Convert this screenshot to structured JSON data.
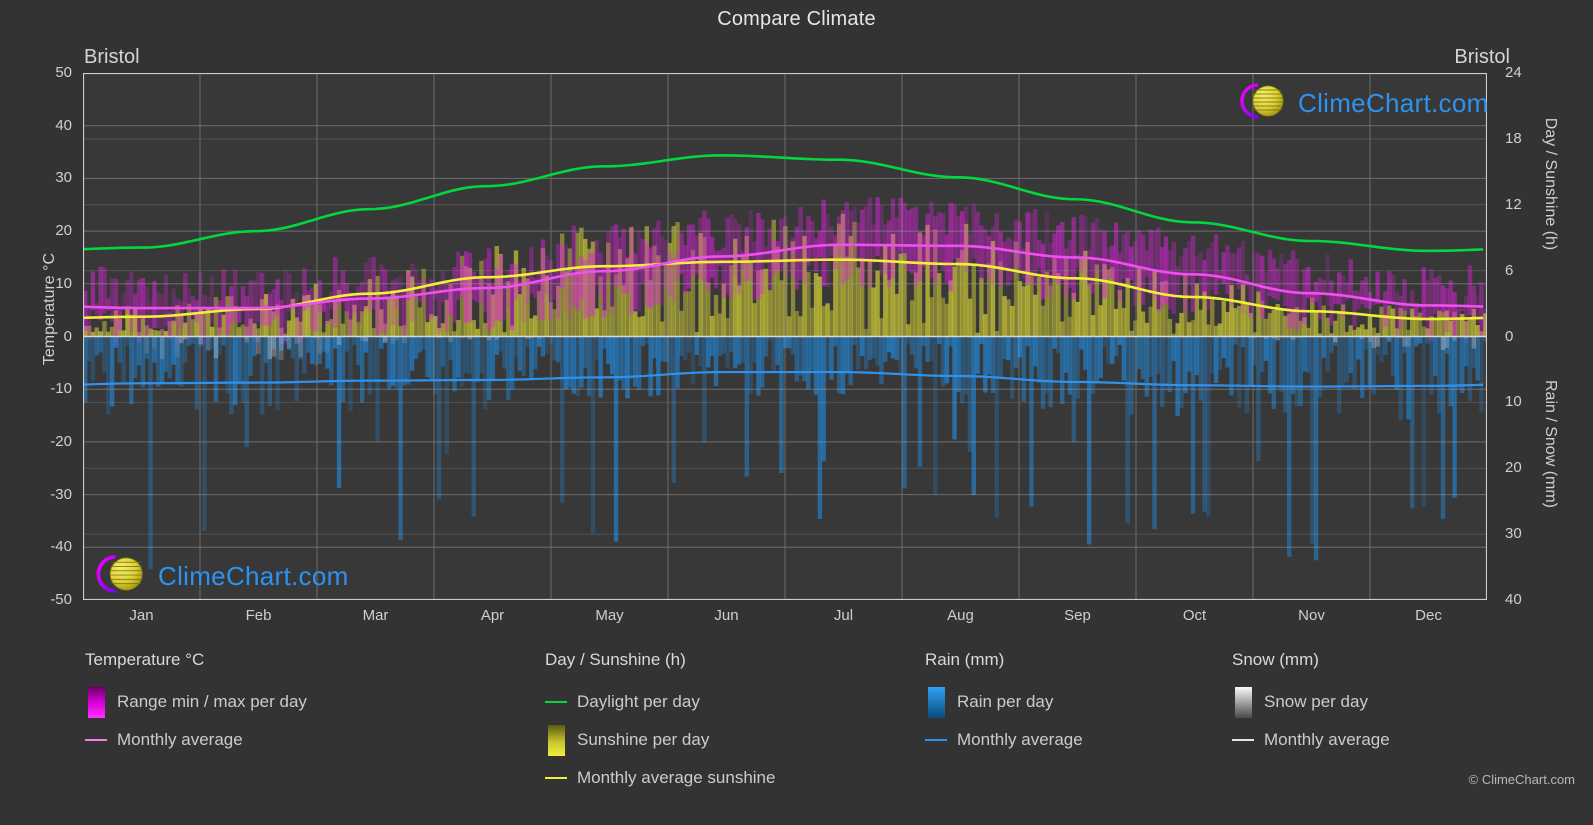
{
  "header": {
    "title": "Compare Climate",
    "station_left": "Bristol",
    "station_right": "Bristol"
  },
  "branding": {
    "logo_text": "ClimeChart.com",
    "copyright": "© ClimeChart.com"
  },
  "axes": {
    "left_title": "Temperature °C",
    "right_top_title": "Day / Sunshine (h)",
    "right_bottom_title": "Rain / Snow (mm)",
    "left_ticks": [
      "50",
      "40",
      "30",
      "20",
      "10",
      "0",
      "-10",
      "-20",
      "-30",
      "-40",
      "-50"
    ],
    "right_ticks": [
      "24",
      "18",
      "12",
      "6",
      "0",
      "10",
      "20",
      "30",
      "40"
    ],
    "x_ticks": [
      "Jan",
      "Feb",
      "Mar",
      "Apr",
      "May",
      "Jun",
      "Jul",
      "Aug",
      "Sep",
      "Oct",
      "Nov",
      "Dec"
    ]
  },
  "legend": {
    "temperature": {
      "heading": "Temperature °C",
      "items": [
        {
          "label": "Range min / max per day",
          "swatch": "gradient-magenta",
          "color": "#ff00ff"
        },
        {
          "label": "Monthly average",
          "swatch": "line",
          "color": "#ee7fee"
        }
      ]
    },
    "day_sunshine": {
      "heading": "Day / Sunshine (h)",
      "items": [
        {
          "label": "Daylight per day",
          "swatch": "line",
          "color": "#00d83c"
        },
        {
          "label": "Sunshine per day",
          "swatch": "gradient-yellow",
          "color": "#f0ee28"
        },
        {
          "label": "Monthly average sunshine",
          "swatch": "line",
          "color": "#f2ef3a"
        }
      ]
    },
    "rain": {
      "heading": "Rain (mm)",
      "items": [
        {
          "label": "Rain per day",
          "swatch": "gradient-blue",
          "color": "#1f8fe8"
        },
        {
          "label": "Monthly average",
          "swatch": "line",
          "color": "#2e93f0"
        }
      ]
    },
    "snow": {
      "heading": "Snow (mm)",
      "items": [
        {
          "label": "Snow per day",
          "swatch": "gradient-white",
          "color": "#f2f2f2"
        },
        {
          "label": "Monthly average",
          "swatch": "line",
          "color": "#e6e6e6"
        }
      ]
    }
  },
  "chart_data": {
    "type": "line",
    "title": "Compare Climate",
    "subtitle": "Bristol",
    "xlabel": "",
    "ylabel": "Temperature °C",
    "ylabel_right_top": "Day / Sunshine (h)",
    "ylabel_right_bottom": "Rain / Snow (mm)",
    "ylim": [
      -50,
      50
    ],
    "ylim_right_top": [
      0,
      24
    ],
    "ylim_right_bottom": [
      0,
      40
    ],
    "grid": true,
    "legend_position": "below",
    "categories": [
      "Jan",
      "Feb",
      "Mar",
      "Apr",
      "May",
      "Jun",
      "Jul",
      "Aug",
      "Sep",
      "Oct",
      "Nov",
      "Dec"
    ],
    "series": [
      {
        "name": "Daylight per day",
        "unit": "h",
        "axis": "right_top",
        "color": "#00d83c",
        "values": [
          8.1,
          9.6,
          11.6,
          13.7,
          15.5,
          16.5,
          16.1,
          14.5,
          12.5,
          10.4,
          8.7,
          7.8
        ]
      },
      {
        "name": "Monthly average sunshine",
        "unit": "h",
        "axis": "right_top",
        "color": "#f2ef3a",
        "values": [
          1.8,
          2.5,
          3.9,
          5.4,
          6.4,
          6.8,
          7.0,
          6.6,
          5.3,
          3.6,
          2.3,
          1.6
        ]
      },
      {
        "name": "Monthly average temperature",
        "unit": "°C",
        "axis": "left",
        "color": "#ee7fee",
        "values": [
          5.4,
          5.4,
          7.2,
          9.2,
          12.4,
          15.2,
          17.4,
          17.2,
          15.0,
          11.8,
          8.2,
          5.9
        ]
      },
      {
        "name": "Monthly average rain",
        "unit": "mm",
        "axis": "right_bottom",
        "color": "#2e93f0",
        "values": [
          7.1,
          7.0,
          6.7,
          6.6,
          6.2,
          5.4,
          5.4,
          6.0,
          6.9,
          7.4,
          7.6,
          7.5
        ]
      },
      {
        "name": "Temperature range min / max per day",
        "unit": "°C",
        "axis": "left",
        "color": "#ff00ff",
        "min_values": [
          1.9,
          1.7,
          3.0,
          4.4,
          7.3,
          10.2,
          12.4,
          12.3,
          10.3,
          7.8,
          4.5,
          2.3
        ],
        "max_values": [
          8.9,
          9.1,
          11.4,
          14.0,
          17.4,
          20.2,
          22.4,
          22.1,
          19.6,
          15.7,
          11.8,
          9.4
        ]
      },
      {
        "name": "Sunshine per day",
        "unit": "h",
        "axis": "right_top",
        "color": "#f0ee28",
        "values": [
          1.8,
          2.5,
          3.9,
          5.4,
          6.4,
          6.8,
          7.0,
          6.6,
          5.3,
          3.6,
          2.3,
          1.6
        ]
      },
      {
        "name": "Rain per day",
        "unit": "mm",
        "axis": "right_bottom",
        "color": "#1f8fe8",
        "values": [
          7.1,
          7.0,
          6.7,
          6.6,
          6.2,
          5.4,
          5.4,
          6.0,
          6.9,
          7.4,
          7.6,
          7.5
        ]
      },
      {
        "name": "Snow per day",
        "unit": "mm",
        "axis": "right_bottom",
        "color": "#f2f2f2",
        "values": [
          0.6,
          0.5,
          0.3,
          0.1,
          0.0,
          0.0,
          0.0,
          0.0,
          0.0,
          0.0,
          0.1,
          0.4
        ]
      }
    ]
  }
}
